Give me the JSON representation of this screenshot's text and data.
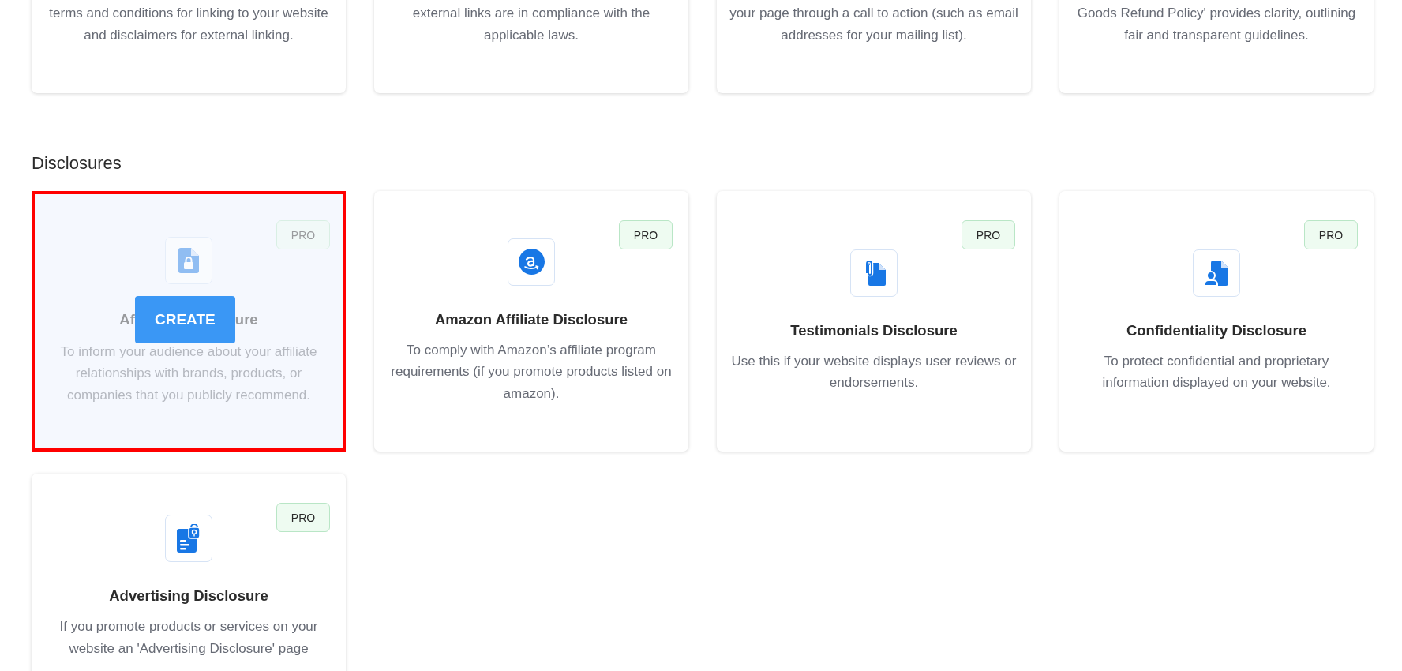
{
  "top_cards": [
    {
      "description": "terms and conditions for linking to your website and disclaimers for external linking."
    },
    {
      "description": "external links are in compliance with the applicable laws."
    },
    {
      "description": "your page through a call to action (such as email addresses for your mailing list)."
    },
    {
      "description": "Goods Refund Policy' provides clarity, outlining fair and transparent guidelines."
    }
  ],
  "section": {
    "heading": "Disclosures",
    "cards": [
      {
        "highlighted": true,
        "badge": "PRO",
        "title_parts": [
          "Af",
          "ure"
        ],
        "button": "CREATE",
        "description": "To inform your audience about your affiliate relationships with brands, products, or companies that you publicly recommend."
      },
      {
        "highlighted": false,
        "badge": "PRO",
        "title": "Amazon Affiliate Disclosure",
        "description": "To comply with Amazon’s affiliate program requirements (if you promote products listed on amazon)."
      },
      {
        "highlighted": false,
        "badge": "PRO",
        "title": "Testimonials Disclosure",
        "description": "Use this if your website displays user reviews or endorsements."
      },
      {
        "highlighted": false,
        "badge": "PRO",
        "title": "Confidentiality Disclosure",
        "description": "To protect confidential and proprietary information displayed on your website."
      },
      {
        "highlighted": false,
        "badge": "PRO",
        "title": "Advertising Disclosure",
        "description": "If you promote products or services on your website an 'Advertising Disclosure' page"
      }
    ]
  }
}
